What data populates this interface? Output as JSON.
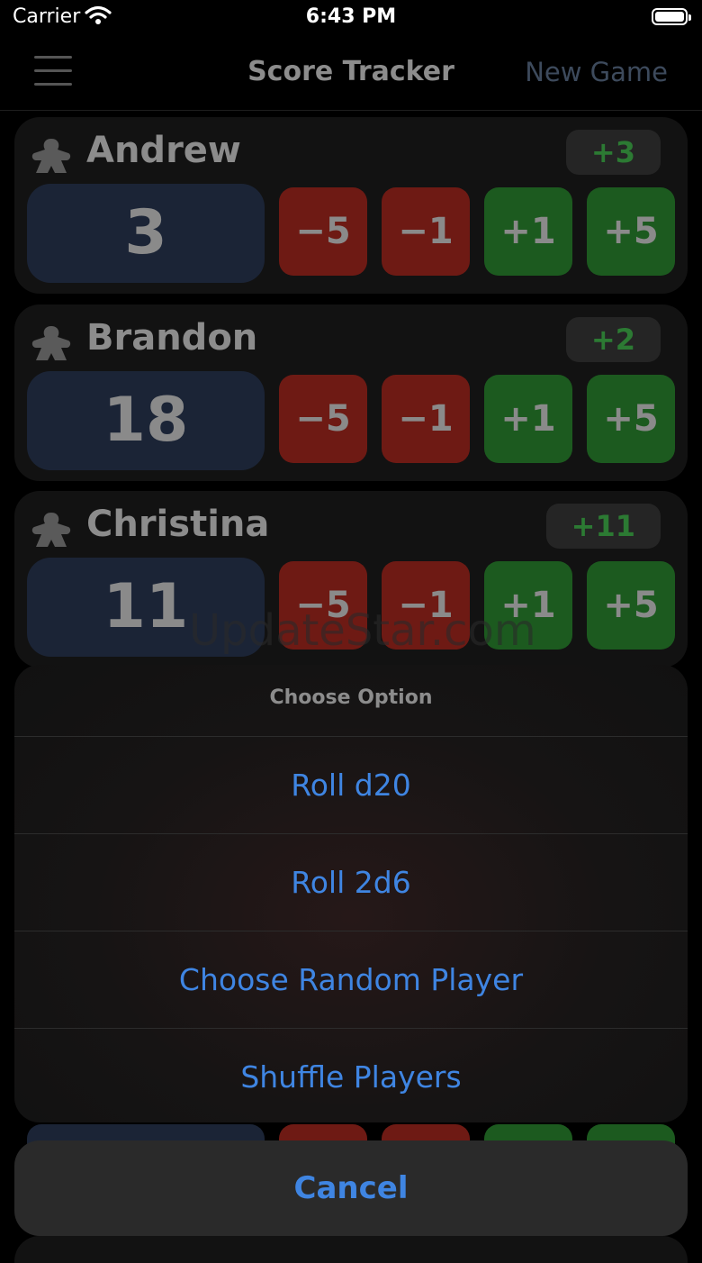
{
  "status_bar": {
    "carrier": "Carrier",
    "time": "6:43 PM"
  },
  "nav": {
    "title": "Score Tracker",
    "new_game": "New Game",
    "menu_icon": "hamburger-menu-icon"
  },
  "buttons": {
    "minus5": "−5",
    "minus1": "−1",
    "plus1": "+1",
    "plus5": "+5"
  },
  "players": [
    {
      "name": "Andrew",
      "score": "3",
      "delta": "+3",
      "icon": "pawn-icon"
    },
    {
      "name": "Brandon",
      "score": "18",
      "delta": "+2",
      "icon": "pawn-icon"
    },
    {
      "name": "Christina",
      "score": "11",
      "delta": "+11",
      "icon": "pawn-icon"
    }
  ],
  "watermark": "UpdateStar.com",
  "action_sheet": {
    "title": "Choose Option",
    "options": [
      "Roll d20",
      "Roll 2d6",
      "Choose Random Player",
      "Shuffle Players"
    ],
    "cancel": "Cancel"
  },
  "colors": {
    "accent_blue": "#3f85e2",
    "delta_green": "#2c7a33",
    "minus_red": "#6e1a14",
    "plus_green": "#1c5a1f",
    "score_bg": "#1b2436"
  }
}
